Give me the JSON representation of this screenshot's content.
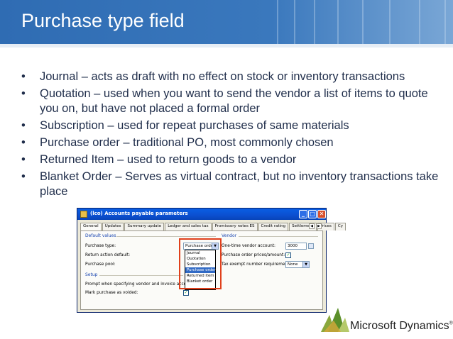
{
  "slide": {
    "title": "Purchase type field",
    "bullet_symbol": "•",
    "bullets": [
      "Journal – acts as draft with no effect on stock or inventory transactions",
      "Quotation – used when you want to send  the vendor a list of items to quote you on, but have not placed a formal order",
      "Subscription – used for repeat purchases of same materials",
      "Purchase order – traditional PO, most commonly chosen",
      "Returned Item – used to return goods to a vendor",
      "Blanket Order – Serves as virtual contract, but no inventory transactions take place"
    ]
  },
  "dialog": {
    "title": "(lco) Accounts payable parameters",
    "window_buttons": {
      "minimize": "_",
      "maximize": "□",
      "close": "✕"
    },
    "tabs": [
      "General",
      "Updates",
      "Summary update",
      "Ledger and sales tax",
      "Promissory notes ES",
      "Credit rating",
      "Settlement",
      "Prices",
      "Cy"
    ],
    "active_tab": "General",
    "tab_scroll": {
      "left": "◀",
      "right": "▶"
    },
    "default_values_label": "Default values",
    "vendor_label": "Vendor",
    "setup_label": "Setup",
    "fields": {
      "purchase_type_label": "Purchase type:",
      "purchase_type_value": "Purchase order",
      "return_action_label": "Return action default:",
      "purchase_pool_label": "Purchase pool:",
      "prompt_label": "Prompt when specifying vendor and invoice account",
      "mark_voided_label": "Mark purchase as voided:",
      "one_time_vendor_label": "One-time vendor account:",
      "one_time_vendor_value": "3000",
      "prices_amount_label": "Purchase order prices/amount:",
      "tax_exempt_label": "Tax exempt number requirement:",
      "tax_exempt_value": "None",
      "prices_amount_checked": true,
      "mark_voided_checked": true
    },
    "dropdown_options": [
      "Journal",
      "Quotation",
      "Subscription",
      "Purchase order",
      "Returned item",
      "Blanket order"
    ],
    "dropdown_selected": "Purchase order",
    "arrow_glyph": "▼",
    "check_glyph": "✓",
    "highlight_color": "#e0401c"
  },
  "logo": {
    "text": "Microsoft Dynamics",
    "registered": "®"
  },
  "colors": {
    "banner": "#2f6cb3",
    "bullet_text": "#1f2d4a",
    "dialog_title": "#0a5fe4"
  }
}
